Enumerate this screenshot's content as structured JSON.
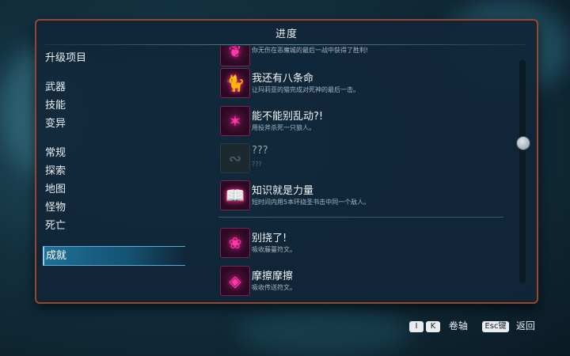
{
  "window": {
    "title": "进度"
  },
  "sidebar": {
    "items": [
      {
        "label": "升级项目"
      },
      {
        "label": "武器"
      },
      {
        "label": "技能"
      },
      {
        "label": "变异"
      },
      {
        "label": "常规"
      },
      {
        "label": "探索"
      },
      {
        "label": "地图"
      },
      {
        "label": "怪物"
      },
      {
        "label": "死亡"
      },
      {
        "label": "成就",
        "selected": true
      }
    ]
  },
  "achievements": [
    {
      "name": "",
      "desc": "你无伤在恶魔城的最后一战中获得了胜利!",
      "icon": "wings-icon",
      "partial": true
    },
    {
      "name": "我还有八条命",
      "desc": "让玛莉亚的猫完成对死神的最后一击。",
      "icon": "cat-icon"
    },
    {
      "name": "能不能别乱动?!",
      "desc": "用投斧杀死一只狼人。",
      "icon": "werewolf-icon"
    },
    {
      "name": "???",
      "desc": "???",
      "icon": "locked-icon",
      "locked": true
    },
    {
      "name": "知识就是力量",
      "desc": "短时间内用5本环绕圣书击中同一个敌人。",
      "icon": "book-icon"
    },
    {
      "name": "别挠了!",
      "desc": "吸收藤蔓符文。",
      "icon": "vine-rune-icon"
    },
    {
      "name": "摩擦摩擦",
      "desc": "吸收传送符文。",
      "icon": "teleport-rune-icon"
    }
  ],
  "footer": {
    "scroll_keys": [
      "I",
      "K"
    ],
    "scroll_label": "卷轴",
    "back_key": "Esc键",
    "back_label": "返回"
  },
  "colors": {
    "accent": "#ff3aa8",
    "selected": "#1f6f98",
    "border": "#8a4a3c"
  }
}
